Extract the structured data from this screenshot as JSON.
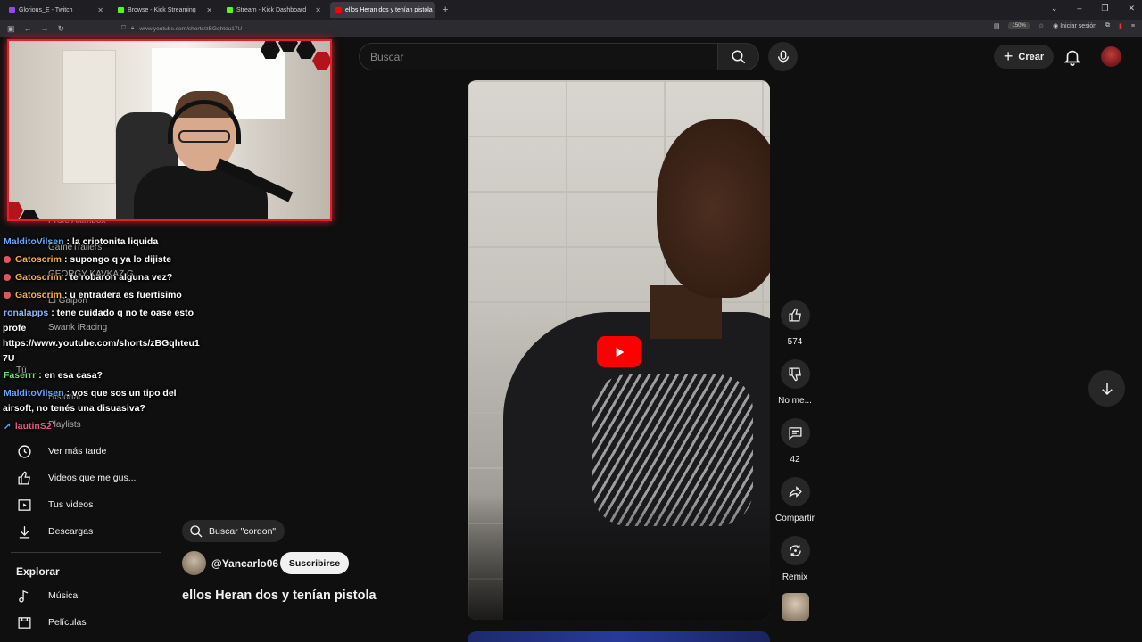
{
  "browser": {
    "tabs": [
      {
        "title": "Glorious_E - Twitch",
        "color": "#9146ff",
        "active": false
      },
      {
        "title": "Browse - Kick Streaming",
        "color": "#53fc18",
        "active": false
      },
      {
        "title": "Stream - Kick Dashboard",
        "color": "#53fc18",
        "active": false
      },
      {
        "title": "ellos Heran dos y tenían pistola",
        "color": "#ff0000",
        "active": true
      }
    ],
    "url": "www.youtube.com/shorts/zBGqhteu17U",
    "zoom": "150%",
    "signin": "Iniciar sesión"
  },
  "header": {
    "search_placeholder": "Buscar",
    "create_label": "Crear"
  },
  "sidebar": {
    "items": [
      {
        "label": "Ver más tarde",
        "icon": "clock-icon"
      },
      {
        "label": "Videos que me gus...",
        "icon": "thumb-up-icon"
      },
      {
        "label": "Tus videos",
        "icon": "play-square-icon"
      },
      {
        "label": "Descargas",
        "icon": "download-icon"
      }
    ],
    "explore_title": "Explorar",
    "explore_items": [
      {
        "label": "Música",
        "icon": "music-note-icon"
      },
      {
        "label": "Películas",
        "icon": "film-icon"
      }
    ],
    "ghost_items": [
      "Profe Akimbox",
      "GameTrailers",
      "GEORGY KAVKAZ G",
      "El Galpon",
      "Swank iRacing",
      "Tú",
      "Historial",
      "Playlists"
    ]
  },
  "chat": [
    {
      "user": "MalditoVilsen",
      "color": "#6aa8ff",
      "text": ": la criptonita liquida",
      "dot": false
    },
    {
      "user": "Gatoscrim",
      "color": "#f0b340",
      "text": ": supongo q ya lo dijiste",
      "dot": true
    },
    {
      "user": "Gatoscrim",
      "color": "#f0b340",
      "text": ": te robaron alguna vez?",
      "dot": true
    },
    {
      "user": "Gatoscrim",
      "color": "#f0b340",
      "text": ": u entradera es fuertisimo",
      "dot": true
    },
    {
      "user": "ronalapps",
      "color": "#8ab4ff",
      "text": ": tene cuidado q no te oase esto",
      "dot": false
    },
    {
      "user": "",
      "color": "#ffffff",
      "text": "profe",
      "dot": false
    },
    {
      "user": "",
      "color": "#ffffff",
      "text": "https://www.youtube.com/shorts/zBGqhteu1",
      "dot": false
    },
    {
      "user": "",
      "color": "#ffffff",
      "text": "7U",
      "dot": false
    },
    {
      "user": "Faserrr",
      "color": "#6fdc6f",
      "text": ": en esa casa?",
      "dot": false
    },
    {
      "user": "MalditoVilsen",
      "color": "#6aa8ff",
      "text": ": vos que sos un tipo del",
      "dot": false
    },
    {
      "user": "",
      "color": "#ffffff",
      "text": "airsoft, no tenés una disuasiva?",
      "dot": false
    },
    {
      "user": "lautinS2",
      "color": "#e05a8a",
      "text": "",
      "dot": false
    }
  ],
  "short": {
    "search_chip": "Buscar \"cordon\"",
    "channel": "@Yancarlo06",
    "subscribe": "Suscribirse",
    "title": "ellos Heran dos y tenían pistola",
    "likes": "574",
    "dislike_label": "No me...",
    "comments": "42",
    "share": "Compartir",
    "remix": "Remix"
  }
}
